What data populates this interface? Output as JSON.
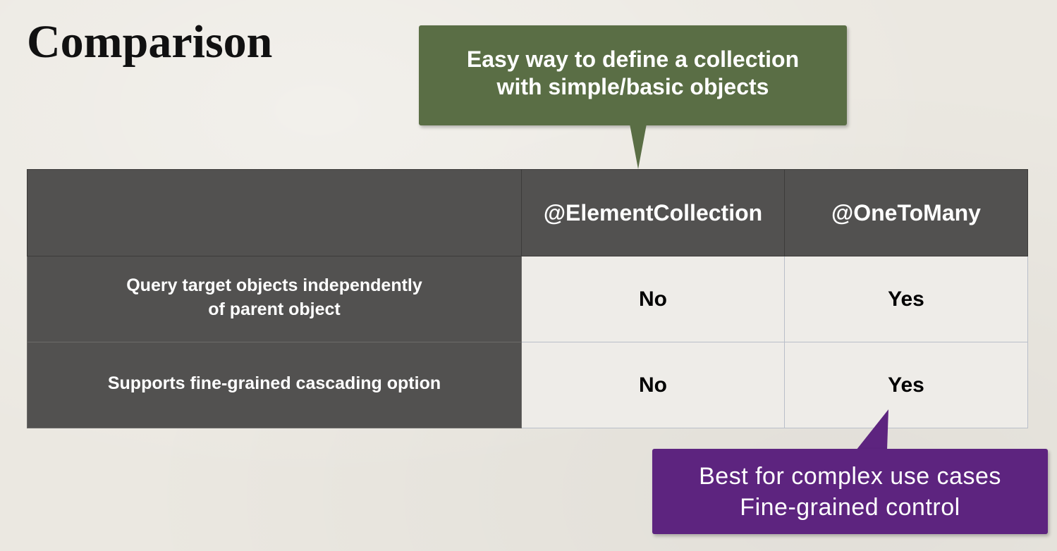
{
  "slide": {
    "title": "Comparison"
  },
  "callouts": {
    "top": {
      "line1": "Easy way to define a collection",
      "line2": "with simple/basic objects",
      "color": "#5a6e45"
    },
    "bottom": {
      "line1": "Best for complex use cases",
      "line2": "Fine-grained control",
      "color": "#5d247f"
    }
  },
  "table": {
    "headers": [
      "",
      "@ElementCollection",
      "@OneToMany"
    ],
    "rows": [
      {
        "label_line1": "Query target objects independently",
        "label_line2": "of parent object",
        "values": [
          "No",
          "Yes"
        ]
      },
      {
        "label_line1": "Supports fine-grained cascading option",
        "label_line2": "",
        "values": [
          "No",
          "Yes"
        ]
      }
    ],
    "header_bg": "#525150",
    "cell_bg": "#eeece8"
  }
}
